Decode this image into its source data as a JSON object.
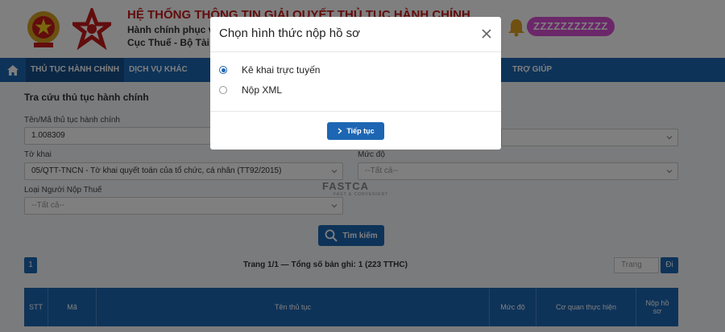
{
  "header": {
    "title": "HỆ THỐNG THÔNG TIN GIẢI QUYẾT THỦ TỤC HÀNH CHÍNH",
    "subtitle1": "Hành chính phục v",
    "subtitle2": "Cục Thuế - Bộ Tài",
    "username": "ZZZZZZZZZZZ"
  },
  "nav": {
    "items": [
      "THỦ TỤC HÀNH CHÍNH",
      "DỊCH VỤ KHÁC"
    ],
    "help": "TRỢ GIÚP"
  },
  "form": {
    "section_title": "Tra cứu thủ tục hành chính",
    "code_label": "Tên/Mã thủ tục hành chính",
    "code_value": "1.008309",
    "declaration_label": "Tờ khai",
    "declaration_value": "05/QTT-TNCN - Tờ khai quyết toán của tổ chức, cá nhân (TT92/2015)",
    "level_label": "Mức độ",
    "level_placeholder": "--Tất cả--",
    "taxpayer_label": "Loại Người Nộp Thuế",
    "taxpayer_placeholder": "--Tất cả--",
    "search_button": "Tìm kiếm"
  },
  "watermark": {
    "brand": "FASTCA",
    "tagline": "FAST & CONVENIENT"
  },
  "pagination": {
    "current_page": "1",
    "info": "Trang 1/1 — Tổng số bản ghi: 1 (223 TTHC)",
    "page_input_placeholder": "Trang",
    "go_button": "Đi"
  },
  "table": {
    "columns": [
      "STT",
      "Mã",
      "Tên thủ tục",
      "Mức độ",
      "Cơ quan thực hiện",
      "Nộp hồ sơ"
    ]
  },
  "modal": {
    "title": "Chọn hình thức nộp hồ sơ",
    "options": [
      {
        "label": "Kê khai trực tuyến",
        "checked": true
      },
      {
        "label": "Nộp XML",
        "checked": false
      }
    ],
    "continue_button": "Tiếp tục"
  },
  "colors": {
    "primary": "#1d66b3",
    "title_red": "#c41a1a",
    "username_bg": "#d64fd2"
  }
}
